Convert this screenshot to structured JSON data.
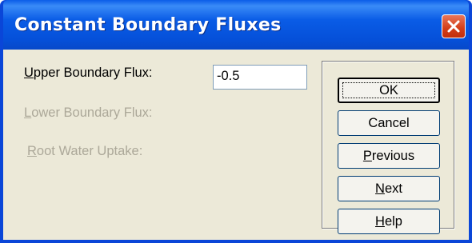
{
  "window": {
    "title": "Constant Boundary Fluxes"
  },
  "fields": {
    "upper": {
      "mnemonic": "U",
      "rest": "pper Boundary Flux:",
      "value": "-0.5",
      "enabled": true
    },
    "lower": {
      "mnemonic": "L",
      "rest": "ower Boundary Flux:",
      "enabled": false
    },
    "root": {
      "mnemonic": "R",
      "rest": "oot Water Uptake:",
      "enabled": false
    }
  },
  "buttons": {
    "ok": {
      "label": "OK"
    },
    "cancel": {
      "label": "Cancel"
    },
    "previous": {
      "mnemonic": "P",
      "rest": "revious"
    },
    "next": {
      "mnemonic": "N",
      "rest": "ext"
    },
    "help": {
      "mnemonic": "H",
      "rest": "elp"
    }
  },
  "icons": {
    "close": "close-icon"
  },
  "colors": {
    "titlebar": "#0a5ce6",
    "client": "#ece9d8",
    "disabled_text": "#aca899",
    "close_button": "#d33d18"
  }
}
